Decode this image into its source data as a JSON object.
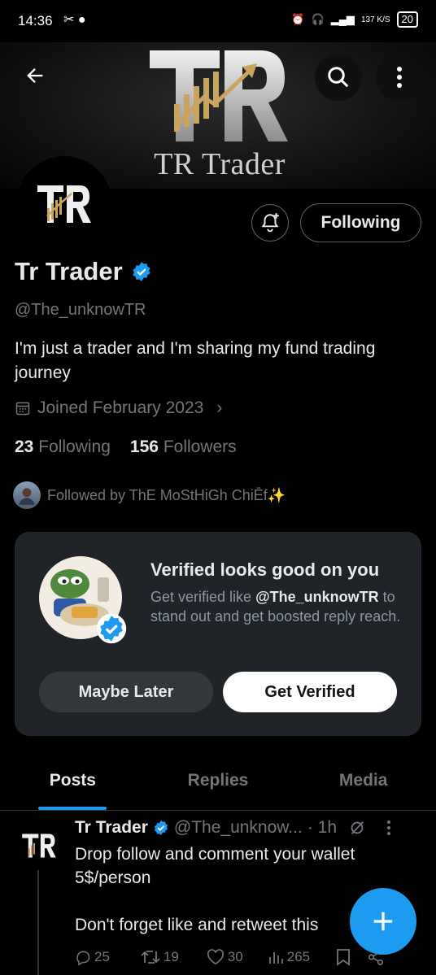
{
  "status_bar": {
    "time": "14:36",
    "net_speed": "137 K/S",
    "battery": "20"
  },
  "banner": {
    "logo_text": "TR",
    "title": "TR Trader"
  },
  "profile": {
    "avatar_text": "TR",
    "following_button": "Following",
    "name": "Tr Trader",
    "handle": "@The_unknowTR",
    "bio": "I'm just a trader and I'm sharing my fund trading journey",
    "joined": "Joined February 2023",
    "following_count": "23",
    "following_label": "Following",
    "followers_count": "156",
    "followers_label": "Followers",
    "followed_by": "Followed by ThE MoStHiGh ChiĒf✨"
  },
  "verified_card": {
    "title": "Verified looks good on you",
    "body_prefix": "Get verified like ",
    "body_handle": "@The_unknowTR",
    "body_suffix": " to stand out and get boosted reply reach.",
    "maybe_later": "Maybe Later",
    "get_verified": "Get Verified"
  },
  "tabs": [
    {
      "label": "Posts",
      "active": true
    },
    {
      "label": "Replies",
      "active": false
    },
    {
      "label": "Media",
      "active": false
    }
  ],
  "post": {
    "author": "Tr Trader",
    "handle": "@The_unknow...",
    "time": "· 1h",
    "text": "Drop follow and comment your wallet\n5$/person\n\nDon't forget like and retweet this",
    "replies": "25",
    "reposts": "19",
    "likes": "30",
    "views": "265"
  },
  "colors": {
    "accent": "#1d9bf0",
    "card_bg": "#202327",
    "muted": "#71767b",
    "gold": "#b8975a"
  }
}
